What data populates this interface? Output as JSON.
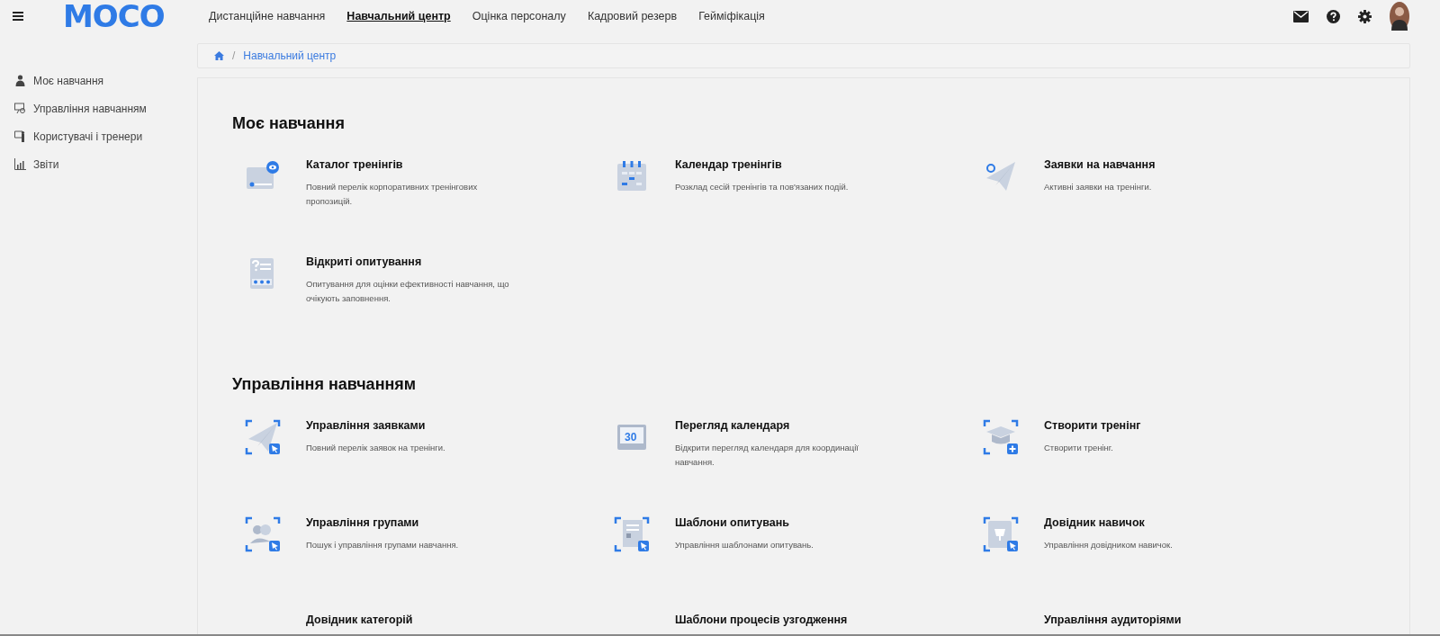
{
  "logo": "MOCO",
  "nav": [
    {
      "label": "Дистанційне навчання",
      "selected": false
    },
    {
      "label": "Навчальний центр",
      "selected": true
    },
    {
      "label": "Оцінка персоналу",
      "selected": false
    },
    {
      "label": "Кадровий резерв",
      "selected": false
    },
    {
      "label": "Гейміфікація",
      "selected": false
    }
  ],
  "sidebar": {
    "items": [
      {
        "label": "Моє навчання",
        "kind": "person"
      },
      {
        "label": "Управління навчанням",
        "kind": "board"
      },
      {
        "label": "Користувачі і тренери",
        "kind": "trainer"
      },
      {
        "label": "Звіти",
        "kind": "chart"
      }
    ]
  },
  "breadcrumb": {
    "separator": "/",
    "items": [
      "Навчальний центр"
    ]
  },
  "sections": [
    {
      "title": "Моє навчання",
      "tiles": [
        {
          "title": "Каталог тренінгів",
          "description": "Повний перелік корпоративних тренінгових пропозицій.",
          "kind": "catalog"
        },
        {
          "title": "Календар тренінгів",
          "description": "Розклад сесій тренінгів та пов'язаних подій.",
          "kind": "calendar"
        },
        {
          "title": "Заявки на навчання",
          "description": "Активні заявки на тренінги.",
          "kind": "plane"
        },
        {
          "title": "Відкриті опитування",
          "description": "Опитування для оцінки ефективності навчання, що очікують заповнення.",
          "kind": "survey"
        }
      ]
    },
    {
      "title": "Управління навчанням",
      "tiles": [
        {
          "title": "Управління заявками",
          "description": "Повний перелік заявок на тренінги.",
          "kind": "plane-select"
        },
        {
          "title": "Перегляд календаря",
          "description": "Відкрити перегляд календаря для координації навчання.",
          "kind": "calendar30",
          "icon_text": "30"
        },
        {
          "title": "Створити тренінг",
          "description": "Створити тренінг.",
          "kind": "cap-add"
        },
        {
          "title": "Управління групами",
          "description": "Пошук і управління групами навчання.",
          "kind": "group-select"
        },
        {
          "title": "Шаблони опитувань",
          "description": "Управління шаблонами опитувань.",
          "kind": "doc-select"
        },
        {
          "title": "Довідник навичок",
          "description": "Управління довідником навичок.",
          "kind": "book-select"
        },
        {
          "title": "Довідник категорій"
        },
        {
          "title": "Шаблони процесів узгодження"
        },
        {
          "title": "Управління аудиторіями"
        }
      ]
    }
  ]
}
